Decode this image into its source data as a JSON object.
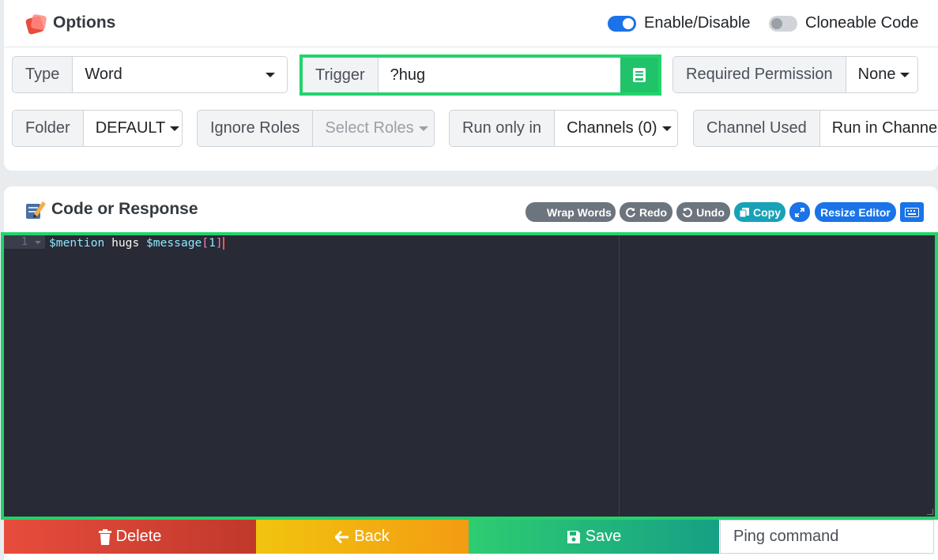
{
  "options": {
    "title": "Options",
    "enable_label": "Enable/Disable",
    "enable_on": true,
    "cloneable_label": "Cloneable Code",
    "cloneable_on": false
  },
  "fields": {
    "type": {
      "label": "Type",
      "value": "Word"
    },
    "trigger": {
      "label": "Trigger",
      "value": "?hug"
    },
    "permission": {
      "label": "Required Permission",
      "value": "None"
    },
    "folder": {
      "label": "Folder",
      "value": "DEFAULT"
    },
    "ignore_roles": {
      "label": "Ignore Roles",
      "placeholder": "Select Roles"
    },
    "run_only_in": {
      "label": "Run only in",
      "value": "Channels (0)"
    },
    "channel_used": {
      "label": "Channel Used",
      "value": "Run in Channel"
    }
  },
  "code": {
    "title": "Code or Response",
    "toolbar": {
      "wrap": "Wrap Words",
      "redo": "Redo",
      "undo": "Undo",
      "copy": "Copy",
      "resize": "Resize Editor"
    },
    "line_number": "1",
    "tokens": {
      "mention": "$mention",
      "text": " hugs ",
      "message": "$message",
      "open": "[",
      "index": "1",
      "close": "]"
    }
  },
  "actions": {
    "delete": "Delete",
    "back": "Back",
    "save": "Save",
    "description": "Ping command"
  },
  "colors": {
    "accent_green": "#22d36b",
    "toggle_on": "#1a73e8",
    "editor_bg": "#282a36"
  }
}
